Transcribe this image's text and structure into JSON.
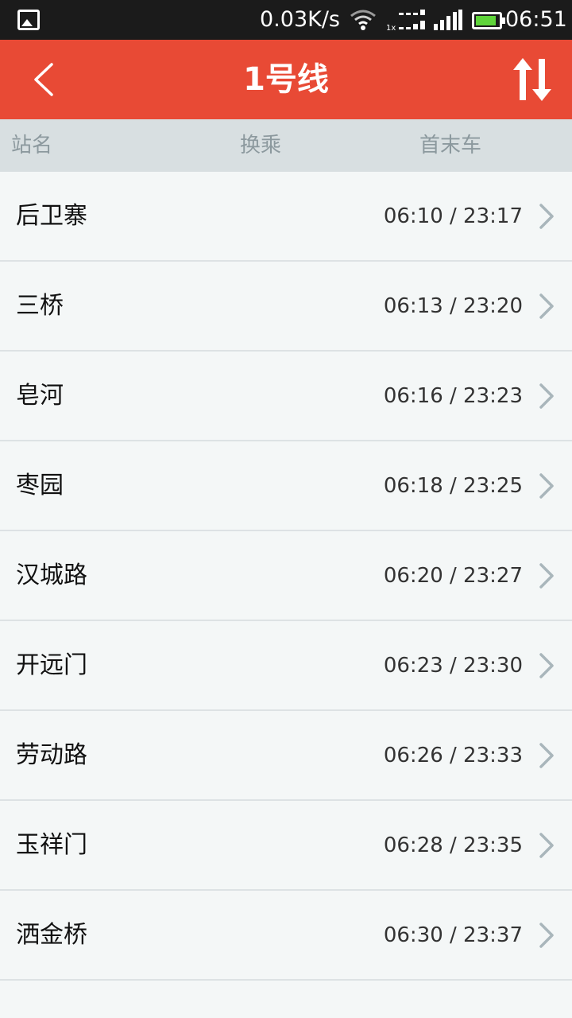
{
  "status_bar": {
    "network_speed": "0.03K/s",
    "net_type_label": "1x",
    "time": "06:51",
    "battery_color": "#5fd43a",
    "battery_level": 0.9
  },
  "title_bar": {
    "back_icon": "chevron-left-icon",
    "title": "1号线",
    "sort_icon": "swap-vertical-icon",
    "color": "#e84a35"
  },
  "columns": {
    "name": "站名",
    "transfer": "换乘",
    "times": "首末车"
  },
  "stations": [
    {
      "name": "后卫寨",
      "times": "06:10 / 23:17"
    },
    {
      "name": "三桥",
      "times": "06:13 / 23:20"
    },
    {
      "name": "皂河",
      "times": "06:16 / 23:23"
    },
    {
      "name": "枣园",
      "times": "06:18 / 23:25"
    },
    {
      "name": "汉城路",
      "times": "06:20 / 23:27"
    },
    {
      "name": "开远门",
      "times": "06:23 / 23:30"
    },
    {
      "name": "劳动路",
      "times": "06:26 / 23:33"
    },
    {
      "name": "玉祥门",
      "times": "06:28 / 23:35"
    },
    {
      "name": "洒金桥",
      "times": "06:30 / 23:37"
    }
  ]
}
